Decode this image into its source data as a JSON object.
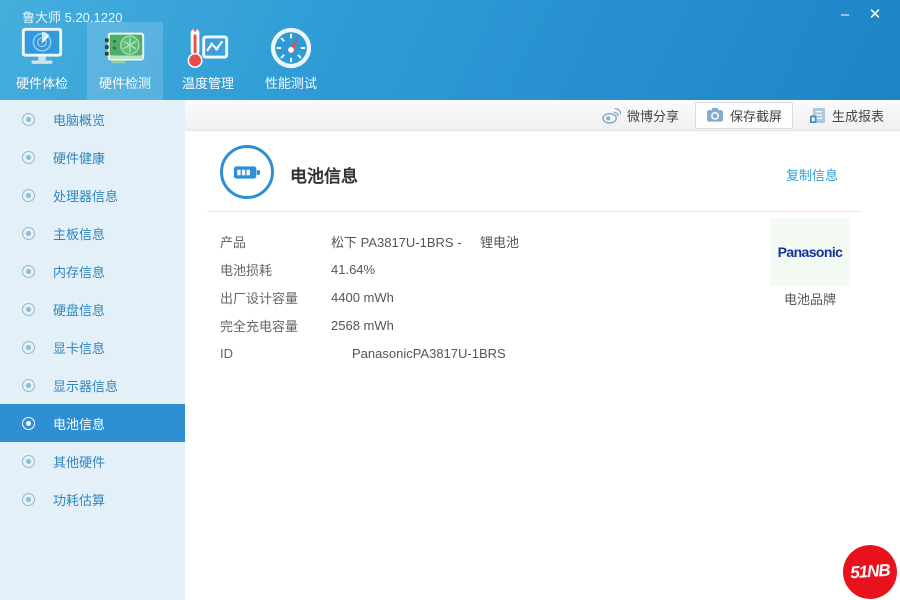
{
  "window": {
    "title": "鲁大师 5.20.1220",
    "minimize": "–",
    "close": "✕"
  },
  "top_nav": {
    "tabs": [
      {
        "label": "硬件体检",
        "icon": "monitor-scan-icon",
        "selected": false
      },
      {
        "label": "硬件检测",
        "icon": "gpu-card-icon",
        "selected": true
      },
      {
        "label": "温度管理",
        "icon": "thermometer-chart-icon",
        "selected": false
      },
      {
        "label": "性能测试",
        "icon": "gauge-icon",
        "selected": false
      }
    ]
  },
  "toolbar": {
    "buttons": [
      {
        "label": "微博分享",
        "icon": "weibo-icon"
      },
      {
        "label": "保存截屏",
        "icon": "camera-icon"
      },
      {
        "label": "生成报表",
        "icon": "report-icon"
      }
    ]
  },
  "sidebar": {
    "items": [
      {
        "label": "电脑概览",
        "selected": false
      },
      {
        "label": "硬件健康",
        "selected": false
      },
      {
        "label": "处理器信息",
        "selected": false
      },
      {
        "label": "主板信息",
        "selected": false
      },
      {
        "label": "内存信息",
        "selected": false
      },
      {
        "label": "硬盘信息",
        "selected": false
      },
      {
        "label": "显卡信息",
        "selected": false
      },
      {
        "label": "显示器信息",
        "selected": false
      },
      {
        "label": "电池信息",
        "selected": true
      },
      {
        "label": "其他硬件",
        "selected": false
      },
      {
        "label": "功耗估算",
        "selected": false
      }
    ]
  },
  "main": {
    "title": "电池信息",
    "copy_link": "复制信息",
    "fields": [
      {
        "label": "产品",
        "value": "松下 PA3817U-1BRS -",
        "extra": "锂电池"
      },
      {
        "label": "电池损耗",
        "value": "41.64%",
        "extra": ""
      },
      {
        "label": "出厂设计容量",
        "value": "4400 mWh",
        "extra": ""
      },
      {
        "label": "完全充电容量",
        "value": "2568 mWh",
        "extra": ""
      },
      {
        "label": "ID",
        "value": "PanasonicPA3817U-1BRS",
        "extra": ""
      }
    ],
    "brand": {
      "logo": "Panasonic",
      "caption": "电池品牌"
    }
  },
  "watermark": {
    "text": "51NB"
  },
  "colors": {
    "banner_blue": "#2d9ad5",
    "selected_row_blue": "#2e8fd2",
    "sidebar_bg": "#e4f0f7",
    "link_blue": "#2b9fd9",
    "panasonic_blue": "#16349c",
    "watermark_red": "#e8121c"
  }
}
